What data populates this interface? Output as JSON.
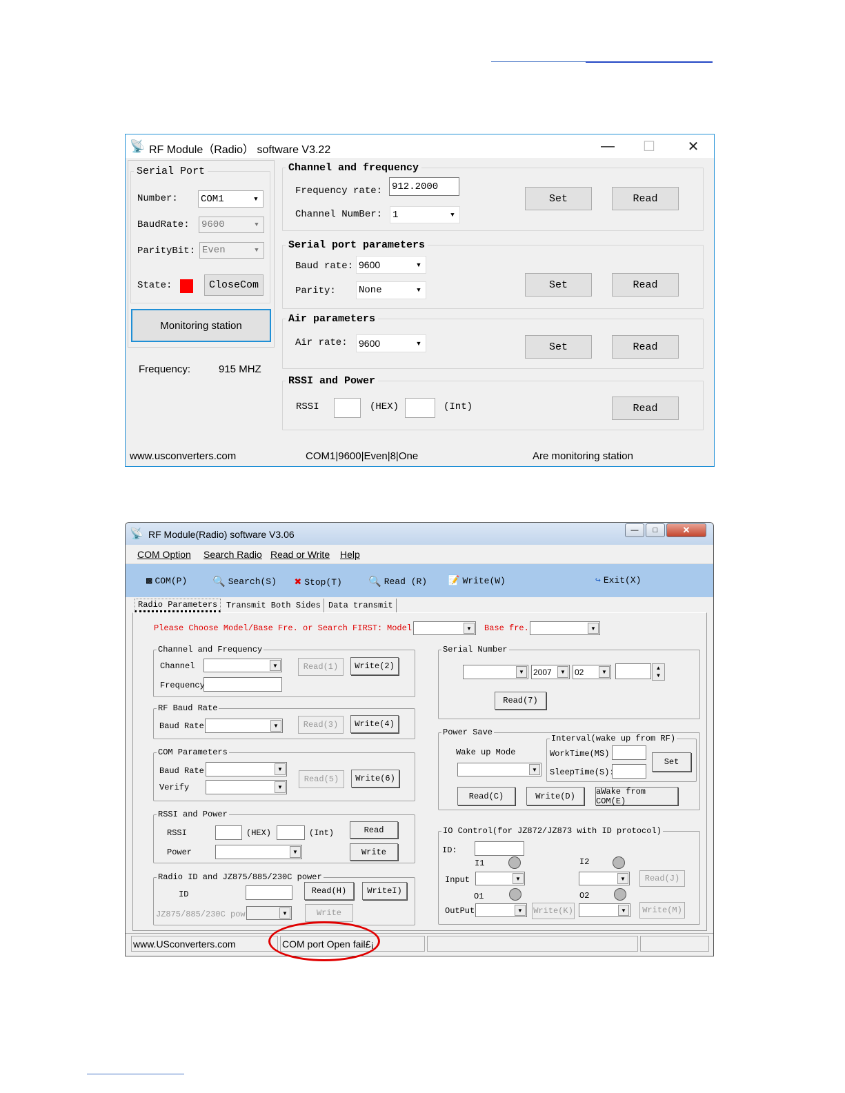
{
  "colors": {
    "accent": "#1f8fd6",
    "red_label": "#e00000",
    "state_indicator": "#ff0000",
    "toolbar": "#a8c9ec",
    "highlight_circle": "#e00000"
  },
  "win1": {
    "title": "RF Module（Radio） software V3.22",
    "controls": {
      "minimize": "—",
      "maximize": "☐",
      "close": "✕"
    },
    "serial_port": {
      "legend": "Serial Port",
      "number_label": "Number:",
      "number_value": "COM1",
      "baud_label": "BaudRate:",
      "baud_value": "9600",
      "parity_label": "ParityBit:",
      "parity_value": "Even",
      "state_label": "State:",
      "close_button": "CloseCom"
    },
    "monitoring_button": "Monitoring station",
    "frequency_label": "Frequency:",
    "frequency_value": "915 MHZ",
    "channel": {
      "legend": "Channel and frequency",
      "freq_label": "Frequency rate:",
      "freq_value": "912.2000",
      "channel_label": "Channel NumBer:",
      "channel_value": "1",
      "set": "Set",
      "read": "Read"
    },
    "serial_params": {
      "legend": "Serial port parameters",
      "baud_label": "Baud rate:",
      "baud_value": "9600",
      "parity_label": "Parity:",
      "parity_value": "None",
      "set": "Set",
      "read": "Read"
    },
    "air": {
      "legend": "Air parameters",
      "air_label": "Air rate:",
      "air_value": "9600",
      "set": "Set",
      "read": "Read"
    },
    "rssi": {
      "legend": "RSSI and Power",
      "rssi_label": "RSSI",
      "hex": "(HEX)",
      "int": "(Int)",
      "read": "Read"
    },
    "status": {
      "website": "www.usconverters.com",
      "port": "COM1|9600|Even|8|One",
      "state": "Are monitoring station"
    }
  },
  "win2": {
    "title": "RF Module(Radio) software  V3.06",
    "menu": [
      "COM Option",
      "Search Radio",
      "Read or Write",
      "Help"
    ],
    "toolbar": {
      "com": "COM(P)",
      "search": "Search(S)",
      "stop": "Stop(T)",
      "read": "Read (R)",
      "write": "Write(W)",
      "exit": "Exit(X)"
    },
    "tabs": [
      "Radio Parameters",
      "Transmit Both Sides",
      "Data transmit"
    ],
    "choose": {
      "text": "Please Choose Model/Base Fre. or Search FIRST:",
      "model_label": "Model",
      "base_label": "Base fre."
    },
    "chfreq": {
      "legend": "Channel and Frequency",
      "channel": "Channel",
      "frequency": "Frequency",
      "read": "Read(1)",
      "write": "Write(2)"
    },
    "rfbaud": {
      "legend": "RF Baud Rate",
      "baud": "Baud Rate",
      "read": "Read(3)",
      "write": "Write(4)"
    },
    "comparams": {
      "legend": "COM Parameters",
      "baud": "Baud Rate",
      "verify": "Verify",
      "read": "Read(5)",
      "write": "Write(6)"
    },
    "rssipower": {
      "legend": "RSSI and Power",
      "rssi": "RSSI",
      "hex": "(HEX)",
      "int": "(Int)",
      "power": "Power",
      "read": "Read",
      "write": "Write"
    },
    "radioid": {
      "legend": "Radio ID and JZ875/885/230C power",
      "id": "ID",
      "pow": "JZ875/885/230C pow",
      "read": "Read(H)",
      "write_id": "WriteI)",
      "write": "Write"
    },
    "serial": {
      "legend": "Serial Number",
      "year": "2007",
      "month": "02",
      "read": "Read(7)"
    },
    "powersave": {
      "legend": "Power Save",
      "wake_label": "Wake up Mode",
      "interval_legend": "Interval(wake up from RF)",
      "worktime": "WorkTime(MS)",
      "sleeptime": "SleepTime(S):",
      "set": "Set",
      "read": "Read(C)",
      "write": "Write(D)",
      "awake": "aWake from COM(E)"
    },
    "io": {
      "legend": "IO Control(for JZ872/JZ873 with ID protocol)",
      "id": "ID:",
      "i1": "I1",
      "i2": "I2",
      "input": "Input",
      "o1": "O1",
      "o2": "O2",
      "output": "OutPut",
      "read": "Read(J)",
      "write_k": "Write(K)",
      "write_m": "Write(M)"
    },
    "status": {
      "website": "www.USconverters.com",
      "message": "COM port Open fail£¡"
    }
  }
}
